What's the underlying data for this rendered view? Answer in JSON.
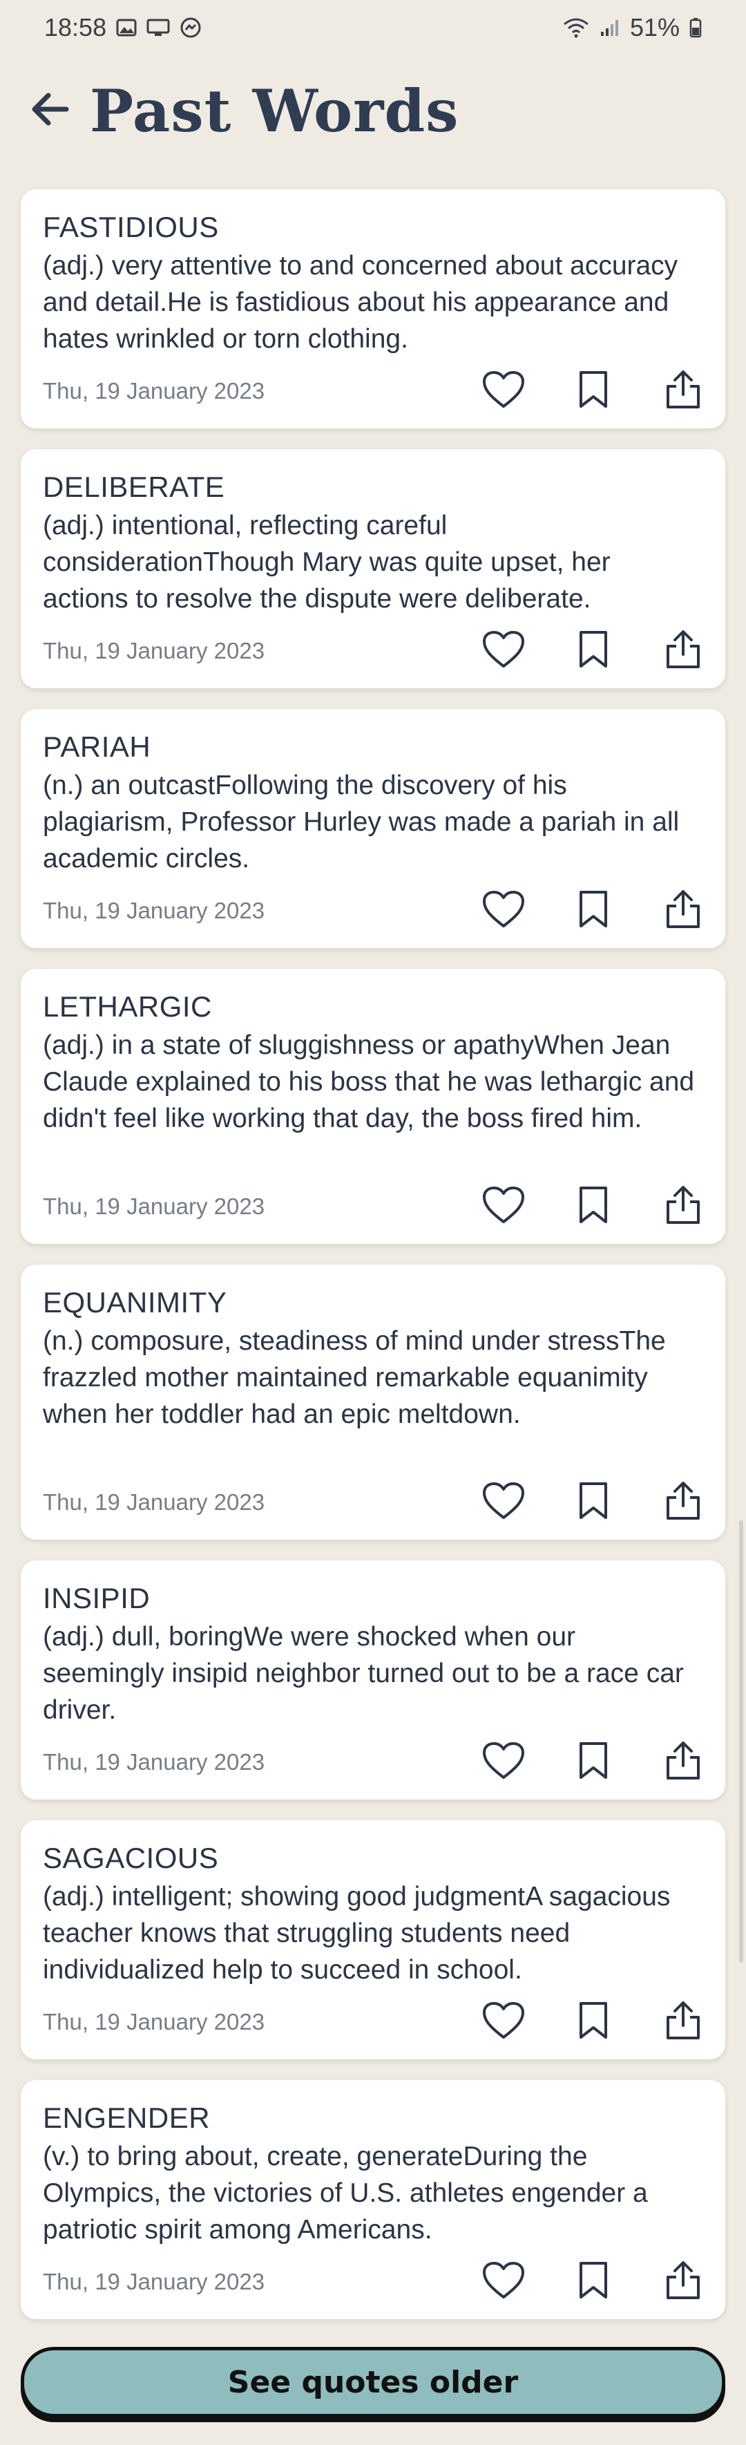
{
  "status_bar": {
    "time": "18:58",
    "battery": "51%",
    "left_icons": [
      "gallery-icon",
      "screen-cast-icon",
      "messenger-icon"
    ],
    "right_icons": [
      "wifi-icon",
      "signal-icon",
      "battery-icon"
    ]
  },
  "header": {
    "title": "Past Words",
    "back_icon": "arrow-left-icon"
  },
  "words": [
    {
      "word": "FASTIDIOUS",
      "definition": "(adj.) very attentive to and concerned about accuracy and detail.He is fastidious about his appearance and hates wrinkled or torn clothing.",
      "date": "Thu, 19 January 2023"
    },
    {
      "word": "DELIBERATE",
      "definition": "(adj.) intentional, reflecting careful considerationThough Mary was quite upset, her actions to resolve the dispute were deliberate.",
      "date": "Thu, 19 January 2023"
    },
    {
      "word": "PARIAH",
      "definition": "(n.) an outcastFollowing the discovery of his plagiarism, Professor Hurley was made a pariah in all academic circles.",
      "date": "Thu, 19 January 2023"
    },
    {
      "word": "LETHARGIC",
      "definition": "(adj.) in a state of sluggishness or apathyWhen Jean Claude explained to his boss that he was lethargic and didn't feel like working that day, the boss fired him.",
      "date": "Thu, 19 January 2023"
    },
    {
      "word": "EQUANIMITY",
      "definition": "(n.) composure, steadiness of mind under stressThe frazzled mother maintained remarkable equanimity when her toddler had an epic meltdown.",
      "date": "Thu, 19 January 2023"
    },
    {
      "word": "INSIPID",
      "definition": "(adj.) dull, boringWe were shocked when our seemingly insipid neighbor turned out to be a race car driver.",
      "date": "Thu, 19 January 2023"
    },
    {
      "word": "SAGACIOUS",
      "definition": "(adj.) intelligent; showing good judgmentA sagacious teacher knows that struggling students need individualized help to succeed in school.",
      "date": "Thu, 19 January 2023"
    },
    {
      "word": "ENGENDER",
      "definition": "(v.) to bring about, create, generateDuring the Olympics, the victories of U.S. athletes engender a patriotic spirit among Americans.",
      "date": "Thu, 19 January 2023"
    }
  ],
  "actions": {
    "like_icon": "heart-icon",
    "bookmark_icon": "bookmark-icon",
    "share_icon": "share-icon"
  },
  "see_older_label": "See quotes older",
  "colors": {
    "background": "#efebe2",
    "card": "#ffffff",
    "title": "#2f3c52",
    "button": "#8fbcbc"
  }
}
